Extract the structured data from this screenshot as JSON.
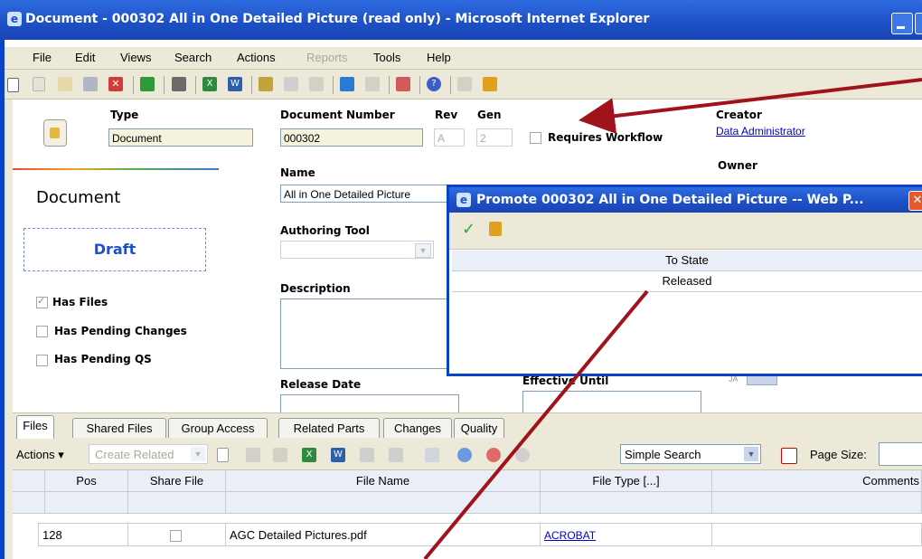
{
  "window": {
    "title": "Document - 000302 All in One Detailed Picture (read only) - Microsoft Internet Explorer"
  },
  "menu": [
    "File",
    "Edit",
    "Views",
    "Search",
    "Actions",
    "Reports",
    "Tools",
    "Help"
  ],
  "form": {
    "type_label": "Type",
    "type_value": "Document",
    "docnum_label": "Document Number",
    "docnum_value": "000302",
    "rev_label": "Rev",
    "rev_value": "A",
    "gen_label": "Gen",
    "gen_value": "2",
    "requires_workflow": "Requires Workflow",
    "creator_label": "Creator",
    "creator_value": "Data Administrator",
    "owner_label": "Owner",
    "name_label": "Name",
    "name_value": "All in One Detailed Picture",
    "authoring_label": "Authoring Tool",
    "description_label": "Description",
    "release_label": "Release Date",
    "effective_label": "Effective Until",
    "small_field_value": "JA"
  },
  "sidebar": {
    "heading": "Document",
    "state": "Draft",
    "has_files": "Has Files",
    "has_pending_changes": "Has Pending Changes",
    "has_pending_qs": "Has Pending QS"
  },
  "dialog": {
    "title": "Promote 000302 All in One Detailed Picture -- Web P...",
    "column": "To State",
    "value": "Released"
  },
  "tabs": [
    "Files",
    "Shared Files",
    "Group Access",
    "Related Parts",
    "Changes",
    "Quality"
  ],
  "grid_toolbar": {
    "actions": "Actions",
    "create_related": "Create Related",
    "search_mode": "Simple Search",
    "page_size_label": "Page Size:"
  },
  "grid": {
    "columns": [
      "Pos",
      "Share File",
      "File Name",
      "File Type [...]",
      "Comments"
    ],
    "rows": [
      {
        "pos": "128",
        "file_name": "AGC Detailed Pictures.pdf",
        "file_type": "ACROBAT"
      }
    ]
  },
  "colors": {
    "title_blue": "#1d4fc4",
    "annotation_arrow": "#a0131a"
  }
}
